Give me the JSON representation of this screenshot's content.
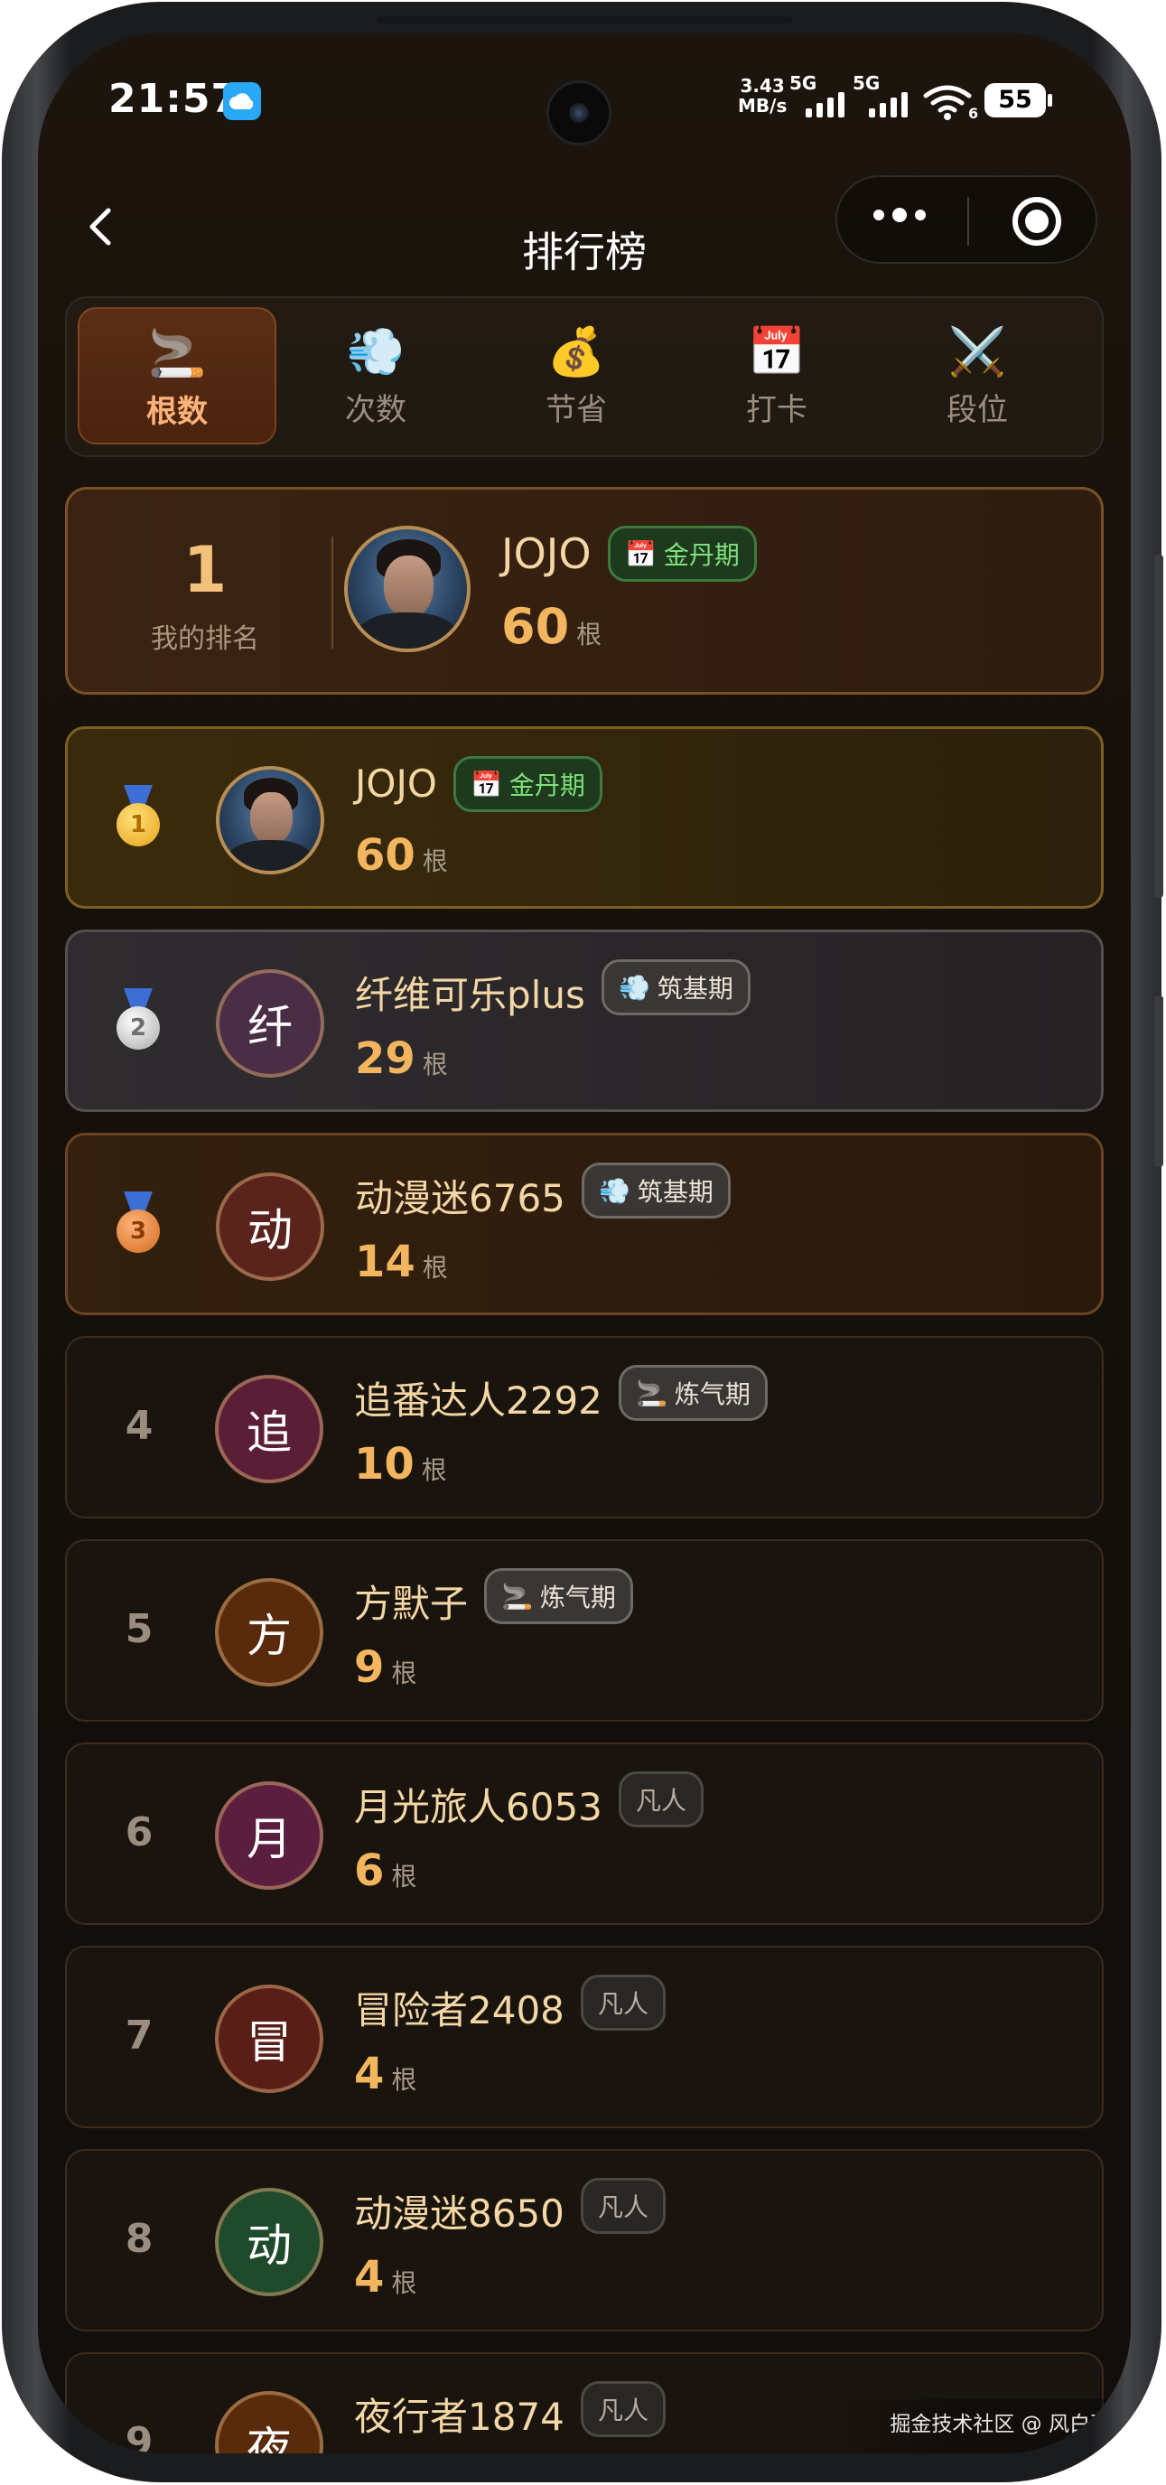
{
  "status_bar": {
    "time": "21:57",
    "net_speed_value": "3.43",
    "net_speed_unit": "MB/s",
    "signal1_label": "5G",
    "signal2_label": "5G",
    "wifi_label": "6",
    "battery": "55"
  },
  "nav": {
    "title": "排行榜",
    "back_icon": "chevron-left-icon",
    "more_icon": "more-dots-icon",
    "close_icon": "target-circle-icon"
  },
  "tabs": [
    {
      "label": "根数",
      "icon": "🚬",
      "active": true
    },
    {
      "label": "次数",
      "icon": "💨",
      "active": false
    },
    {
      "label": "节省",
      "icon": "💰",
      "active": false
    },
    {
      "label": "打卡",
      "icon": "📅",
      "active": false
    },
    {
      "label": "段位",
      "icon": "⚔️",
      "active": false
    }
  ],
  "my_rank": {
    "rank": "1",
    "rank_label": "我的排名",
    "name": "JOJO",
    "badge": "金丹期",
    "badge_icon": "📅",
    "count": "60",
    "unit": "根"
  },
  "leaderboard": [
    {
      "rank": "1",
      "medal": "gold",
      "name": "JOJO",
      "avatar_type": "photo",
      "avatar_char": "",
      "avatar_color": "",
      "badge": "金丹期",
      "badge_icon": "📅",
      "badge_style": "gold",
      "count": "60",
      "unit": "根"
    },
    {
      "rank": "2",
      "medal": "silver",
      "name": "纤维可乐plus",
      "avatar_type": "letter",
      "avatar_char": "纤",
      "avatar_color": "#4a2e45",
      "badge": "筑基期",
      "badge_icon": "💨",
      "badge_style": "grey",
      "count": "29",
      "unit": "根"
    },
    {
      "rank": "3",
      "medal": "bronze",
      "name": "动漫迷6765",
      "avatar_type": "letter",
      "avatar_char": "动",
      "avatar_color": "#5a241c",
      "badge": "筑基期",
      "badge_icon": "💨",
      "badge_style": "grey",
      "count": "14",
      "unit": "根"
    },
    {
      "rank": "4",
      "medal": "",
      "name": "追番达人2292",
      "avatar_type": "letter",
      "avatar_char": "追",
      "avatar_color": "#5a1f36",
      "badge": "炼气期",
      "badge_icon": "🚬",
      "badge_style": "grey",
      "count": "10",
      "unit": "根"
    },
    {
      "rank": "5",
      "medal": "",
      "name": "方默子",
      "avatar_type": "letter",
      "avatar_char": "方",
      "avatar_color": "#5a2a0c",
      "badge": "炼气期",
      "badge_icon": "🚬",
      "badge_style": "grey",
      "count": "9",
      "unit": "根"
    },
    {
      "rank": "6",
      "medal": "",
      "name": "月光旅人6053",
      "avatar_type": "letter",
      "avatar_char": "月",
      "avatar_color": "#5a1f3e",
      "badge": "凡人",
      "badge_icon": "",
      "badge_style": "plain",
      "count": "6",
      "unit": "根"
    },
    {
      "rank": "7",
      "medal": "",
      "name": "冒险者2408",
      "avatar_type": "letter",
      "avatar_char": "冒",
      "avatar_color": "#5a1e18",
      "badge": "凡人",
      "badge_icon": "",
      "badge_style": "plain",
      "count": "4",
      "unit": "根"
    },
    {
      "rank": "8",
      "medal": "",
      "name": "动漫迷8650",
      "avatar_type": "letter",
      "avatar_char": "动",
      "avatar_color": "#1f4a2c",
      "badge": "凡人",
      "badge_icon": "",
      "badge_style": "plain",
      "count": "4",
      "unit": "根"
    },
    {
      "rank": "9",
      "medal": "",
      "name": "夜行者1874",
      "avatar_type": "letter",
      "avatar_char": "夜",
      "avatar_color": "#5a2a0c",
      "badge": "凡人",
      "badge_icon": "",
      "badge_style": "plain",
      "count": "",
      "unit": ""
    }
  ],
  "watermark": "掘金技术社区 @ 风白羽",
  "colors": {
    "accent_orange": "#f3b65f",
    "name_text": "#f4d7a4",
    "background": "#150f0b",
    "gold_badge": "#7ee07a"
  }
}
